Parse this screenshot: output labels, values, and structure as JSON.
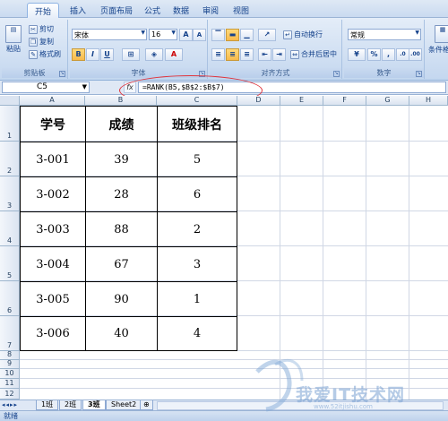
{
  "ribbon_tabs": [
    "开始",
    "插入",
    "页面布局",
    "公式",
    "数据",
    "审阅",
    "视图"
  ],
  "clipboard": {
    "paste": "粘贴",
    "cut": "剪切",
    "copy": "复制",
    "format_painter": "格式刷",
    "label": "剪贴板"
  },
  "font": {
    "name": "宋体",
    "size": "16",
    "grow": "A",
    "shrink": "A",
    "bold": "B",
    "italic": "I",
    "underline": "U",
    "label": "字体"
  },
  "alignment": {
    "wrap": "自动换行",
    "merge": "合并后居中",
    "label": "对齐方式"
  },
  "number": {
    "format": "常规",
    "percent": "%",
    "comma": ",",
    "label": "数字"
  },
  "styles": {
    "label": "条件格式"
  },
  "formula_bar": {
    "name_box": "C5",
    "fx": "fx",
    "formula": "=RANK(B5,$B$2:$B$7)"
  },
  "columns": [
    "A",
    "B",
    "C",
    "D",
    "E",
    "F",
    "G",
    "H"
  ],
  "rows": [
    "1",
    "2",
    "3",
    "4",
    "5",
    "6",
    "7",
    "8",
    "9",
    "10",
    "11",
    "12"
  ],
  "table": {
    "headers": [
      "学号",
      "成绩",
      "班级排名"
    ],
    "rows": [
      [
        "3-001",
        "39",
        "5"
      ],
      [
        "3-002",
        "28",
        "6"
      ],
      [
        "3-003",
        "88",
        "2"
      ],
      [
        "3-004",
        "67",
        "3"
      ],
      [
        "3-005",
        "90",
        "1"
      ],
      [
        "3-006",
        "40",
        "4"
      ]
    ]
  },
  "sheet_tabs": [
    "1班",
    "2班",
    "3班",
    "Sheet2"
  ],
  "active_sheet": "3班",
  "status": "就绪",
  "watermark": {
    "text": "我爱IT技术网",
    "url": "www.52itjishu.com"
  },
  "colors": {
    "accent": "#15428b",
    "highlight": "#e0343c"
  }
}
